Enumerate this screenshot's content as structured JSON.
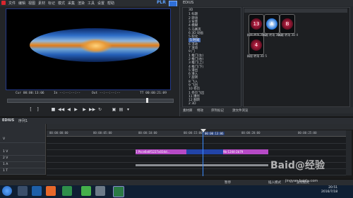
{
  "menubar": {
    "items": [
      "文件",
      "编辑",
      "视图",
      "素材",
      "标记",
      "模式",
      "采集",
      "渲染",
      "工具",
      "设置",
      "帮助"
    ],
    "mode_label": "PLR",
    "bin_title": "EDIUS"
  },
  "player": {
    "cur_label": "Cur 00:00:13:06",
    "in_label": "In --:--:--:--",
    "out_label": "Out --:--:--:--",
    "tt_label": "TT 00:00:21:09"
  },
  "bin": {
    "tree_items": [
      "3D",
      "1 标题",
      "2 转场",
      "3 背景",
      "4 模糊",
      "5 马赛克",
      "6 3D 动画",
      "5 软化",
      "5 时间",
      "6 浮动",
      "7 滚动",
      "9 门",
      "1 推门(左)",
      "2 推门(右)",
      "3 推门(上)",
      "4 推门(下)",
      "5 滑出",
      "6 滑入",
      "7 旋转",
      "8 飞入",
      "9 飞出",
      "10 卷页",
      "1 卷页飞出",
      "11 爆炸",
      "12 翻转",
      "2 3D"
    ],
    "selected_tree_item": "5 时间",
    "thumbnails": [
      {
        "label": "精秘 转场 3D 2",
        "glyph": "13"
      },
      {
        "label": "精秘 转场 3D 3",
        "glyph": "A"
      },
      {
        "label": "精秘 转场 3D 4",
        "glyph": "B"
      },
      {
        "label": "精秘 转场 3D 5",
        "glyph": "4"
      }
    ],
    "footer_tabs": [
      "素材库",
      "特效",
      "序列标记",
      "源文件浏览"
    ]
  },
  "timeline": {
    "title": "EDIUS",
    "sequence_label": "序列1",
    "tracks": [
      "V",
      "1 V",
      "2 V",
      "1 A",
      "1 T"
    ],
    "ruler": [
      "00:00:00:00",
      "00:00:05:00",
      "00:00:10:00",
      "00:00:15:00",
      "00:00:20:00",
      "00:00:25:00"
    ],
    "playhead_time": "00:00:13:06",
    "clip_a": "1 Psce6e8f1227a034d...",
    "clip_b": "9b-1244-2b79",
    "accent": "#3b8cff"
  },
  "status": {
    "left": "暂停",
    "right_1": "插入模式",
    "right_2": "波纹模式"
  },
  "taskbar": {
    "time": "20:51",
    "date": "2016/7/18"
  },
  "watermark": {
    "main": "Baid@经验",
    "sub": "jingyan.baidu.com"
  }
}
